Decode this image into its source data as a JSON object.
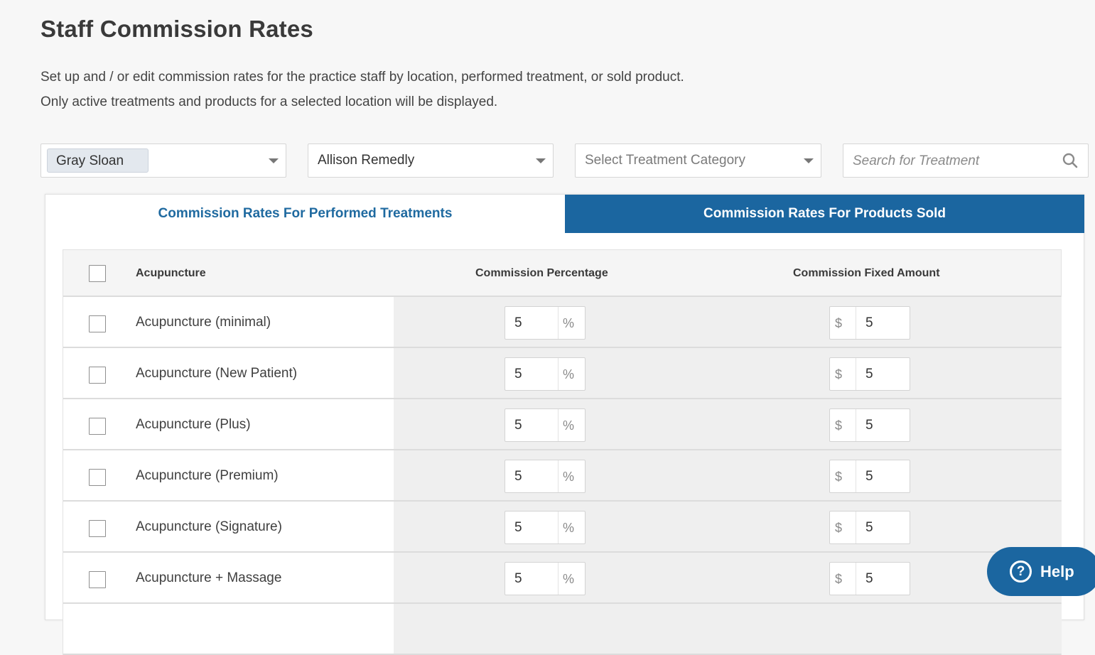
{
  "page": {
    "title": "Staff Commission Rates",
    "description_line1": "Set up and / or edit commission rates for the practice staff by location, performed treatment, or sold product.",
    "description_line2": "Only active treatments and products for a selected location will be displayed."
  },
  "filters": {
    "staff_selected": "Gray Sloan",
    "provider_selected": "Allison Remedly",
    "category_placeholder": "Select Treatment Category",
    "search_placeholder": "Search for Treatment"
  },
  "tabs": [
    {
      "label": "Commission Rates For Performed Treatments",
      "active": true
    },
    {
      "label": "Commission Rates For Products Sold",
      "active": false
    }
  ],
  "table": {
    "headers": {
      "name": "Acupuncture",
      "percentage": "Commission Percentage",
      "fixed": "Commission Fixed Amount"
    },
    "percent_unit": "%",
    "currency_unit": "$",
    "rows": [
      {
        "name": "Acupuncture (minimal)",
        "percentage": "5",
        "fixed": "5"
      },
      {
        "name": "Acupuncture (New Patient)",
        "percentage": "5",
        "fixed": "5"
      },
      {
        "name": "Acupuncture (Plus)",
        "percentage": "5",
        "fixed": "5"
      },
      {
        "name": "Acupuncture (Premium)",
        "percentage": "5",
        "fixed": "5"
      },
      {
        "name": "Acupuncture (Signature)",
        "percentage": "5",
        "fixed": "5"
      },
      {
        "name": "Acupuncture + Massage",
        "percentage": "5",
        "fixed": "5"
      }
    ]
  },
  "help": {
    "label": "Help",
    "icon": "question-circle-icon",
    "color": "#1b66a0"
  },
  "colors": {
    "accent": "#1b66a0",
    "active_tab_text": "#1f6aa0"
  }
}
